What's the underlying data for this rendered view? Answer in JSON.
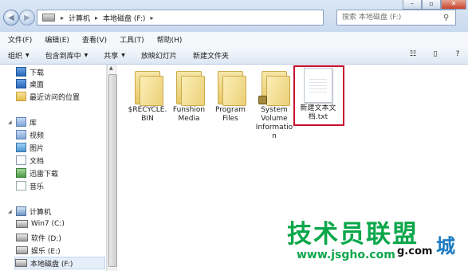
{
  "address_bar": {
    "crumbs": [
      "计算机",
      "本地磁盘 (F:)"
    ],
    "search_placeholder": "搜索 本地磁盘 (F:)"
  },
  "menu": [
    "文件(F)",
    "编辑(E)",
    "查看(V)",
    "工具(T)",
    "帮助(H)"
  ],
  "commands": [
    "组织",
    "包含到库中",
    "共享",
    "放映幻灯片",
    "新建文件夹"
  ],
  "nav": {
    "favorites": [
      "下载",
      "桌面",
      "最近访问的位置"
    ],
    "library_header": "库",
    "libraries": [
      "视频",
      "图片",
      "文档",
      "迅雷下载",
      "音乐"
    ],
    "computer_header": "计算机",
    "drives": [
      "Win7 (C:)",
      "软件 (D:)",
      "娱乐 (E:)",
      "本地磁盘 (F:)"
    ]
  },
  "files": [
    {
      "name": "$RECYCLE.BIN",
      "type": "folder"
    },
    {
      "name": "Funshion Media",
      "type": "folder"
    },
    {
      "name": "Program Files",
      "type": "folder"
    },
    {
      "name": "System Volume Information",
      "type": "folder-locked"
    },
    {
      "name": "新建文本文档.txt",
      "type": "txt",
      "highlighted": true
    }
  ],
  "watermark": {
    "text": "技术员联盟",
    "url": "www.jsgho.com",
    "url_tail": "g.com",
    "extra": "城"
  }
}
